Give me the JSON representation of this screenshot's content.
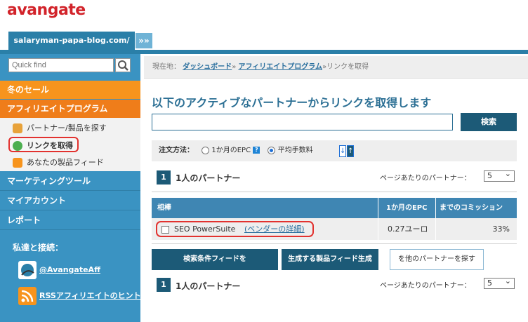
{
  "brand": {
    "logo_text": "avangate",
    "logo_color": "#d2232a"
  },
  "site_tab": {
    "label": "salaryman-papa-blog.com/",
    "expand": "»»"
  },
  "sidebar": {
    "search_placeholder": "Quick find",
    "sections": [
      {
        "label": "冬のセール"
      },
      {
        "label": "アフィリエイトプログラム"
      }
    ],
    "sub_items": [
      {
        "label": "パートナー/製品を探す",
        "icon": "partners-icon"
      },
      {
        "label": "リンクを取得",
        "icon": "link-icon"
      },
      {
        "label": "あなたの製品フィード",
        "icon": "rss-icon"
      }
    ],
    "blue_items": [
      {
        "label": "マーケティングツール"
      },
      {
        "label": "マイアカウント"
      },
      {
        "label": "レポート"
      }
    ],
    "connect_title": "私達と接続：",
    "social": [
      {
        "label": "@AvangateAff",
        "icon": "twitter-icon"
      },
      {
        "label": "RSSアフィリエイトのヒント",
        "icon": "rss-icon"
      }
    ]
  },
  "breadcrumb": {
    "prefix": "現在地：",
    "items": [
      "ダッシュボード",
      "アフィリエイトプログラム"
    ],
    "sep": "»",
    "current": "リンクを取得"
  },
  "main": {
    "title": "以下のアクティブなパートナーからリンクを取得します",
    "search_button": "検索",
    "sort": {
      "label": "注文方法：",
      "options": [
        {
          "label": "1か月のEPC",
          "selected": false
        },
        {
          "label": "平均手数料",
          "selected": true
        }
      ],
      "help": "?",
      "asc_icon": "↓",
      "desc_icon": "↑"
    },
    "pagination_top": {
      "page": "1",
      "count_text": "1人のパートナー",
      "per_page_label": "ページあたりのパートナー：",
      "per_page_value": "5"
    },
    "table": {
      "headers": [
        "相棒",
        "1か月のEPC",
        "までのコミッション"
      ],
      "rows": [
        {
          "partner": "SEO PowerSuite",
          "vendor_link": "(ベンダーの詳細)",
          "epc": "0.27ユーロ",
          "commission": "33%"
        }
      ]
    },
    "buttons": {
      "search_feed": "検索条件フィードを",
      "product_feed": "生成する製品フィード生成",
      "find_more": "を他のパートナーを探す"
    },
    "pagination_bottom": {
      "page": "1",
      "count_text": "1人のパートナー",
      "per_page_label": "ページあたりのパートナー：",
      "per_page_value": "5"
    }
  }
}
